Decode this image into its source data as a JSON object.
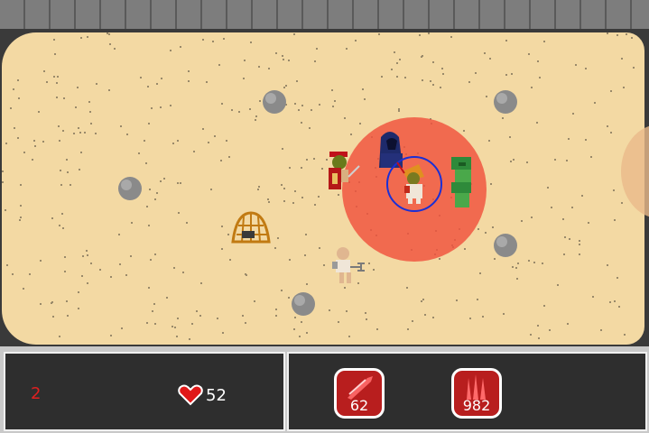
{
  "hud": {
    "wave": "2",
    "health": "52",
    "abilities": [
      {
        "icon": "slash-ability-icon",
        "count": "62"
      },
      {
        "icon": "spikes-ability-icon",
        "count": "982"
      }
    ]
  },
  "colors": {
    "sand": "#f3d9a3",
    "attack_radius": "#f0523d",
    "selection_ring": "#1a2fd6",
    "hud_panel": "#2e2e2e",
    "wave_text": "#e02020"
  }
}
